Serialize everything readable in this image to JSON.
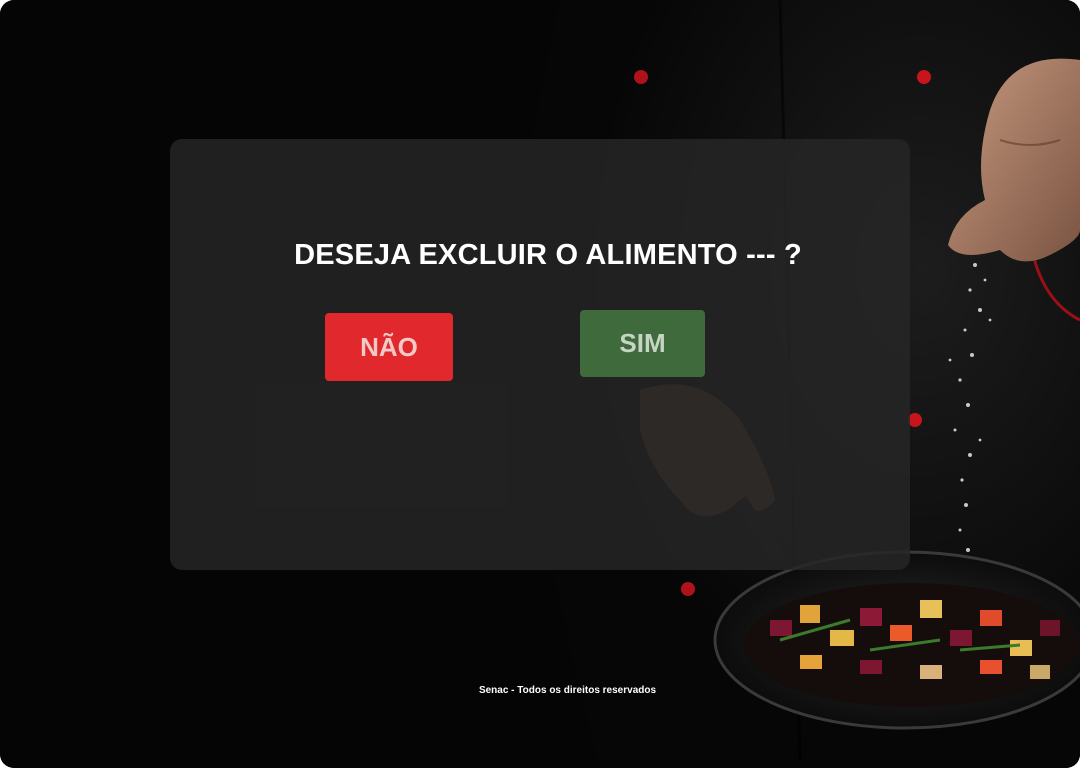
{
  "dialog": {
    "title": "DESEJA EXCLUIR O ALIMENTO --- ?",
    "no_label": "NÃO",
    "yes_label": "SIM"
  },
  "footer": {
    "text": "Senac - Todos os direitos reservados"
  },
  "colors": {
    "no_button": "#e0282d",
    "yes_button": "#3e6a3c",
    "modal_background": "#262626",
    "page_background": "#050505"
  },
  "background_image": {
    "icon": "chef-cooking-photo"
  }
}
